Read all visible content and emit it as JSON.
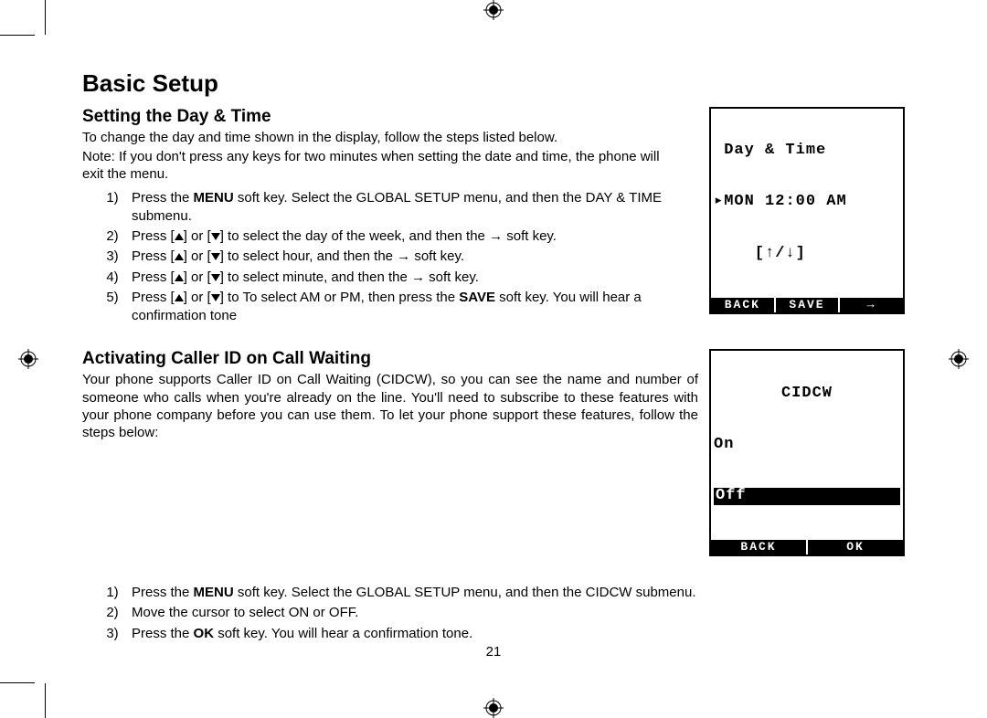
{
  "page_number": "21",
  "title": "Basic Setup",
  "section1": {
    "heading": "Setting the Day & Time",
    "intro": "To change the day and time shown in the display, follow the steps listed below.",
    "note": "Note: If you don't press any keys for two minutes when setting the date and time, the phone will exit the menu.",
    "steps": {
      "s1_a": "Press the ",
      "s1_b": "MENU",
      "s1_c": " soft key. Select the GLOBAL SETUP menu, and then the DAY & TIME submenu.",
      "s2_a": "Press [",
      "s2_b": "] or [",
      "s2_c": "] to select  the day of the week, and then the → soft key.",
      "s3_a": "Press [",
      "s3_b": "] or [",
      "s3_c": "] to select  hour, and then the → soft key.",
      "s4_a": "Press [",
      "s4_b": "] or [",
      "s4_c": "] to select  minute, and then the → soft key.",
      "s5_a": "Press [",
      "s5_b": "] or [",
      "s5_c": "] to To select AM or PM, then press the ",
      "s5_d": "SAVE",
      "s5_e": " soft key. You will hear a confirmation tone"
    },
    "lcd": {
      "line1": " Day & Time",
      "line2": "▸MON 12:00 AM",
      "line3": "    [↑/↓]",
      "soft_left": "BACK",
      "soft_mid": "SAVE",
      "soft_right": "→"
    }
  },
  "section2": {
    "heading": "Activating Caller ID on Call Waiting",
    "intro": "Your phone supports Caller ID on Call Waiting (CIDCW), so you can see the name and number of someone who calls when you're already on the line. You'll need to subscribe to these features with your phone company before you can use them. To let your phone support these features, follow the steps below:",
    "steps": {
      "s1_a": "Press the ",
      "s1_b": "MENU",
      "s1_c": " soft key. Select the GLOBAL SETUP menu, and then the CIDCW submenu.",
      "s2": "Move the cursor to select ON or OFF.",
      "s3_a": "Press the ",
      "s3_b": "OK",
      "s3_c": " soft key. You will hear a confirmation tone."
    },
    "lcd": {
      "title": "CIDCW",
      "opt_on": "On",
      "opt_off": "Off",
      "soft_left": "BACK",
      "soft_right": "OK"
    }
  }
}
